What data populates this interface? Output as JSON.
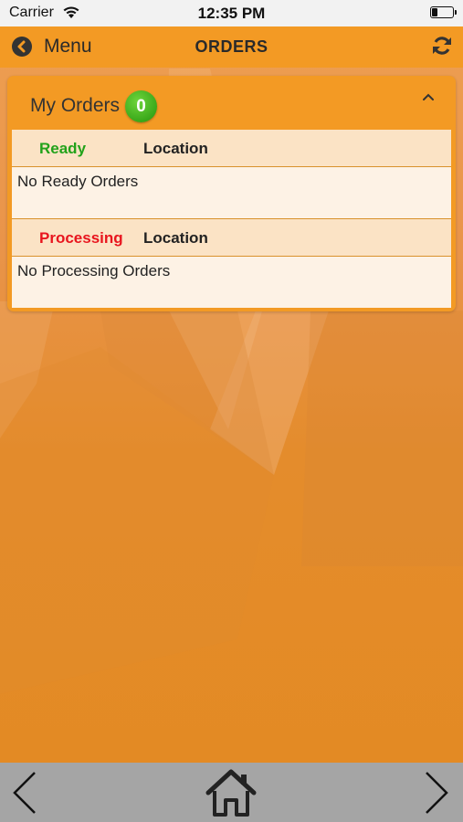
{
  "status_bar": {
    "carrier": "Carrier",
    "time": "12:35 PM"
  },
  "nav": {
    "back_label": "Menu",
    "title": "ORDERS",
    "back_icon": "chevron-left-circle-icon",
    "refresh_icon": "refresh-icon"
  },
  "orders_card": {
    "title": "My Orders",
    "count": "0",
    "ready_section": {
      "status_header": "Ready",
      "location_header": "Location",
      "empty_text": "No Ready Orders"
    },
    "processing_section": {
      "status_header": "Processing",
      "location_header": "Location",
      "empty_text": "No Processing Orders"
    }
  },
  "bottom_bar": {
    "prev_icon": "chevron-left-icon",
    "home_icon": "home-icon",
    "next_icon": "chevron-right-icon"
  },
  "colors": {
    "accent": "#f39a24",
    "ready": "#22a21a",
    "processing": "#e8151e",
    "badge": "#3aa81a"
  }
}
